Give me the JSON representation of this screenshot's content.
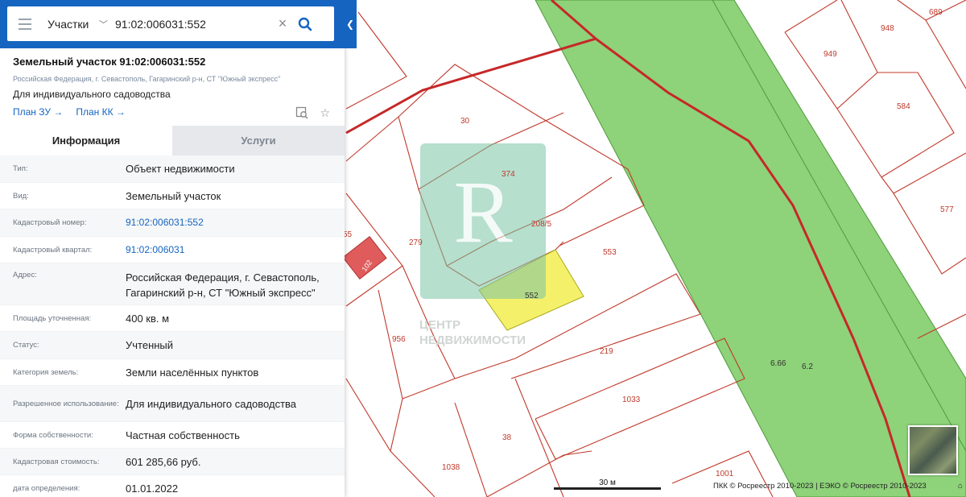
{
  "colors": {
    "accent": "#1565c0",
    "parcel_line": "#c0392b",
    "forest_zone": "#8ed27a",
    "selected_parcel": "#f4f06a",
    "red_parcel": "#e05c5c"
  },
  "search": {
    "type": "Участки",
    "value": "91:02:006031:552"
  },
  "object": {
    "title": "Земельный участок 91:02:006031:552",
    "address": "Российская Федерация, г. Севастополь, Гагаринский р-н, СТ \"Южный экспресс\"",
    "use": "Для индивидуального садоводства",
    "plan_zu": "План ЗУ →",
    "plan_kk": "План КК →"
  },
  "tabs": [
    "Информация",
    "Услуги"
  ],
  "info": [
    {
      "key": "Тип:",
      "value": "Объект недвижимости"
    },
    {
      "key": "Вид:",
      "value": "Земельный участок"
    },
    {
      "key": "Кадастровый номер:",
      "value": "91:02:006031:552"
    },
    {
      "key": "Кадастровый квартал:",
      "value": "91:02:006031"
    },
    {
      "key": "Адрес:",
      "value": "Российская Федерация, г. Севастополь, Гагаринский р-н, СТ \"Южный экспресс\""
    },
    {
      "key": "Площадь уточненная:",
      "value": "400 кв. м"
    },
    {
      "key": "Статус:",
      "value": "Учтенный"
    },
    {
      "key": "Категория земель:",
      "value": "Земли населённых пунктов"
    },
    {
      "key": "Разрешенное использование:",
      "value": "Для индивидуального садоводства"
    },
    {
      "key": "Форма собственности:",
      "value": "Частная собственность"
    },
    {
      "key": "Кадастровая стоимость:",
      "value": "601 285,66 руб."
    },
    {
      "key": "дата определения:",
      "value": "01.01.2022"
    }
  ],
  "map": {
    "parcel_numbers": [
      "30",
      "374",
      "208/5",
      "279",
      "55",
      "553",
      "552",
      "956",
      "219",
      "1033",
      "38",
      "1038",
      "1001",
      "949",
      "948",
      "689",
      "584",
      "577"
    ],
    "zone_labels": [
      "6.66",
      "6.2"
    ],
    "watermark_line1": "ЦЕНТР",
    "watermark_line2": "НЕДВИЖИМОСТИ",
    "red_parcel_label": "102",
    "scale": "30 м",
    "attribution": "ПКК © Росреестр 2010-2023 | ЕЭКО © Росреестр 2010-2023"
  }
}
